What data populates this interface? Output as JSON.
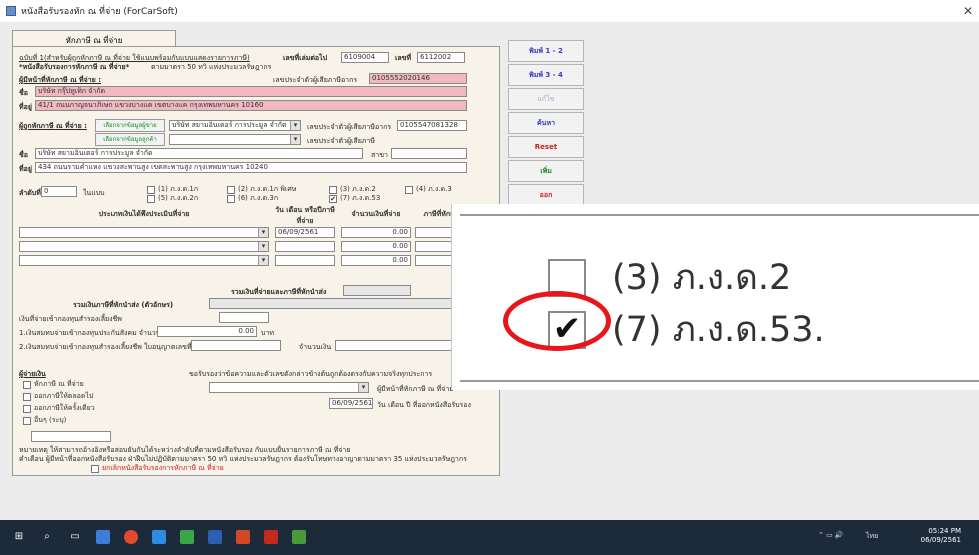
{
  "window": {
    "title": "หนังสือรับรองหัก ณ ที่จ่าย (ForCarSoft)",
    "close_glyph": "✕"
  },
  "form": {
    "tab_label": "หักภาษี ณ ที่จ่าย",
    "header_note": "ฉบับที่ 1(สำหรับผู้ถูกหักภาษี ณ ที่จ่าย ใช้แนบพร้อมกับแบบแสดงรายการภาษี)",
    "cert_title": "*หนังสือรับรองการหักภาษี ณ ที่จ่าย*",
    "cert_subtitle": "ตามมาตรา 50 ทวิ แห่งประมวลรัษฎากร",
    "book_no_label": "เลขที่เล่มต่อไป",
    "book_no_value": "6109004",
    "no_label": "เลขที่",
    "no_value": "6112002",
    "payer": {
      "section_label": "ผู้มีหน้าที่หักภาษี ณ ที่จ่าย :",
      "taxid_label": "เลขประจำตัวผู้เสียภาษีอากร",
      "taxid_value": "0105552020146",
      "name_label": "ชื่อ",
      "name_value": "บริษัท กรุ๊ปทูเท็ก จำกัด",
      "address_label": "ที่อยู่",
      "address_value": "41/1 ถนนกาญจนาภิเษก แขวงบางแค เขตบางแค กรุงเทพมหานคร 10160"
    },
    "payee": {
      "section_label": "ผู้ถูกหักภาษี ณ ที่จ่าย :",
      "pick_button": "เลือกจากข้อมูลผู้ขาย",
      "pick_button2": "เลือกจากข้อมูลลูกค้า",
      "combo_value": "บริษัท สยามอินเตอร์ การประมูล จำกัด",
      "taxid_label": "เลขประจำตัวผู้เสียภาษีอากร",
      "taxid_value": "0105547081328",
      "idcard_label": "เลขประจำตัวผู้เสียภาษี",
      "name_label": "ชื่อ",
      "name_value": "บริษัท สยามอินเตอร์ การประมูล จำกัด",
      "branch_label": "สาขา",
      "address_label": "ที่อยู่",
      "address_value": "434 ถนนรามคำแหง แขวงสะพานสูง เขตสะพานสูง กรุงเทพมหานคร 10240"
    },
    "seq_label": "ลำดับที่",
    "seq_value": "0",
    "seq_suffix": "ในแบบ",
    "forms": [
      {
        "label": "(1) ภ.ง.ด.1ก",
        "checked": false
      },
      {
        "label": "(2) ภ.ง.ด.1ก พิเศษ",
        "checked": false
      },
      {
        "label": "(3) ภ.ง.ด.2",
        "checked": false
      },
      {
        "label": "(4) ภ.ง.ด.3",
        "checked": false
      },
      {
        "label": "(5) ภ.ง.ด.2ก",
        "checked": false
      },
      {
        "label": "(6) ภ.ง.ด.3ก",
        "checked": false
      },
      {
        "label": "(7) ภ.ง.ด.53",
        "checked": true
      }
    ],
    "grid": {
      "col_type": "ประเภทเงินได้พึงประเมินที่จ่าย",
      "col_date": "วัน เดือน หรือปีภาษีที่จ่าย",
      "col_amount": "จำนวนเงินที่จ่าย",
      "col_tax": "ภาษีที่หักและนำส่งไว้",
      "rows": [
        {
          "date": "06/09/2561",
          "amount": "0.00"
        },
        {
          "date": "",
          "amount": "0.00"
        },
        {
          "date": "",
          "amount": "0.00"
        }
      ]
    },
    "total_label": "รวมเงินที่จ่ายและภาษีที่หักนำส่ง",
    "total_text_label": "รวมเงินภาษีที่หักนำส่ง (ตัวอักษร)",
    "fund_label": "เงินที่จ่ายเข้ากองทุนสำรองเลี้ยงชีพ",
    "fund1_label": "1.เงินสมทบจ่ายเข้ากองทุนประกันสังคม จำนวน",
    "fund1_value": "0.00",
    "fund1_unit": "บาท",
    "fund2_label": "2.เงินสมทบจ่ายเข้ากองทุนสำรองเลี้ยงชีพ ใบอนุญาตเลขที่",
    "fund2_amount_label": "จำนวนเงิน",
    "fund2_value": "0.0",
    "payer_type_label": "ผู้จ่ายเงิน",
    "payer_types": [
      {
        "label": "หักภาษี ณ ที่จ่าย",
        "checked": false
      },
      {
        "label": "ออกภาษีให้ตลอดไป",
        "checked": false
      },
      {
        "label": "ออกภาษีให้ครั้งเดียว",
        "checked": false
      },
      {
        "label": "อื่นๆ (ระบุ)",
        "checked": false
      }
    ],
    "certify_text": "ขอรับรองว่าข้อความและตัวเลขดังกล่าวข้างต้นถูกต้องตรงกับความจริงทุกประการ",
    "sign_date": "06/09/2561",
    "sign_date_label": "วัน เดือน ปี ที่ออกหนังสือรับรอง",
    "signer_label": "ผู้มีหน้าที่หักภาษี ณ ที่จ่าย",
    "note1": "หมายเหตุ ให้สามารถอ้างอิงหรือสอบยันกันได้ระหว่างลำดับที่ตามหนังสือรับรอง กับแบบยื่นรายการภาษี ณ ที่จ่าย",
    "note2": "คำเตือน ผู้มีหน้าที่ออกหนังสือรับรอง ฝ่าฝืนไม่ปฏิบัติตามมาตรา 50 ทวิ แห่งประมวลรัษฎากร ต้องรับโทษทางอาญาตามมาตรา 35 แห่งประมวลรัษฎากร",
    "cancel_label": "ยกเลิกหนังสือรับรองการหักภาษี ณ ที่จ่าย"
  },
  "side_buttons": {
    "print12": "พิมพ์ 1 - 2",
    "print34": "พิมพ์ 3 - 4",
    "edit": "แก้ไข",
    "save": "ค้นหา",
    "reset": "Reset",
    "add": "เพิ่ม",
    "exit": "ออก"
  },
  "zoom_panel": {
    "item_top": "(3) ภ.ง.ด.2",
    "item_bottom": "(7) ภ.ง.ด.53.",
    "check_glyph": "✔"
  },
  "taskbar": {
    "time": "05:24 PM",
    "date": "06/09/2561",
    "lang": "ไทย"
  }
}
